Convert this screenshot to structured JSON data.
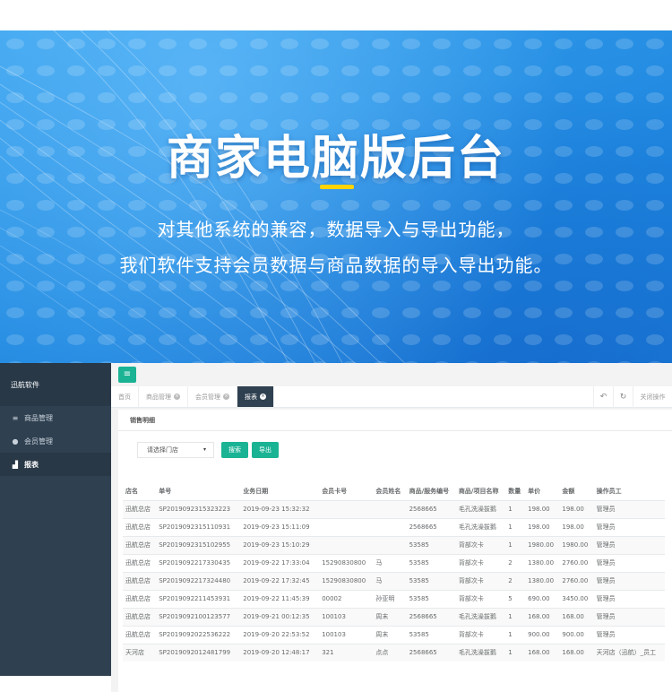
{
  "banner": {
    "title": "商家电脑版后台",
    "line1": "对其他系统的兼容，数据导入与导出功能，",
    "line2": "我们软件支持会员数据与商品数据的导入导出功能。",
    "accent_color": "#ffd400"
  },
  "app": {
    "brand": "迅航软件",
    "menu_icon": "hamburger-icon",
    "sidebar": [
      {
        "label": "商品管理",
        "icon": "list-icon",
        "active": false
      },
      {
        "label": "会员管理",
        "icon": "user-icon",
        "active": false
      },
      {
        "label": "报表",
        "icon": "bar-chart-icon",
        "active": true
      }
    ],
    "tabs": [
      {
        "label": "首页",
        "closable": false,
        "active": false
      },
      {
        "label": "商品管理",
        "closable": true,
        "active": false
      },
      {
        "label": "会员管理",
        "closable": true,
        "active": false
      },
      {
        "label": "报表",
        "closable": true,
        "active": true
      }
    ],
    "tab_actions": {
      "close_ops": "关闭操作"
    },
    "panel_title": "销售明细",
    "filter": {
      "store_select": "请选择门店",
      "search": "搜索",
      "export": "导出"
    },
    "table": {
      "headers": [
        "店名",
        "单号",
        "业务日期",
        "会员卡号",
        "会员姓名",
        "商品/服务编号",
        "商品/项目名称",
        "数量",
        "单价",
        "金额",
        "操作员工"
      ],
      "rows": [
        [
          "迅航总店",
          "SP2019092315323223",
          "2019-09-23 15:32:32",
          "",
          "",
          "2568665",
          "毛孔洗澡拔鹅",
          "1",
          "198.00",
          "198.00",
          "管理员"
        ],
        [
          "迅航总店",
          "SP2019092315110931",
          "2019-09-23 15:11:09",
          "",
          "",
          "2568665",
          "毛孔洗澡拔鹅",
          "1",
          "198.00",
          "198.00",
          "管理员"
        ],
        [
          "迅航总店",
          "SP2019092315102955",
          "2019-09-23 15:10:29",
          "",
          "",
          "53585",
          "背部次卡",
          "1",
          "1980.00",
          "1980.00",
          "管理员"
        ],
        [
          "迅航总店",
          "SP2019092217330435",
          "2019-09-22 17:33:04",
          "15290830800",
          "马",
          "53585",
          "背部次卡",
          "2",
          "1380.00",
          "2760.00",
          "管理员"
        ],
        [
          "迅航总店",
          "SP2019092217324480",
          "2019-09-22 17:32:45",
          "15290830800",
          "马",
          "53585",
          "背部次卡",
          "2",
          "1380.00",
          "2760.00",
          "管理员"
        ],
        [
          "迅航总店",
          "SP2019092211453931",
          "2019-09-22 11:45:39",
          "00002",
          "孙亚明",
          "53585",
          "背部次卡",
          "5",
          "690.00",
          "3450.00",
          "管理员"
        ],
        [
          "迅航总店",
          "SP2019092100123577",
          "2019-09-21 00:12:35",
          "100103",
          "周末",
          "2568665",
          "毛孔洗澡拔鹅",
          "1",
          "168.00",
          "168.00",
          "管理员"
        ],
        [
          "迅航总店",
          "SP2019092022536222",
          "2019-09-20 22:53:52",
          "100103",
          "周末",
          "53585",
          "背部次卡",
          "1",
          "900.00",
          "900.00",
          "管理员"
        ],
        [
          "天河店",
          "SP2019092012481799",
          "2019-09-20 12:48:17",
          "321",
          "点点",
          "2568665",
          "毛孔洗澡拔鹅",
          "1",
          "168.00",
          "168.00",
          "天河店（迅航）_员工"
        ]
      ]
    }
  }
}
